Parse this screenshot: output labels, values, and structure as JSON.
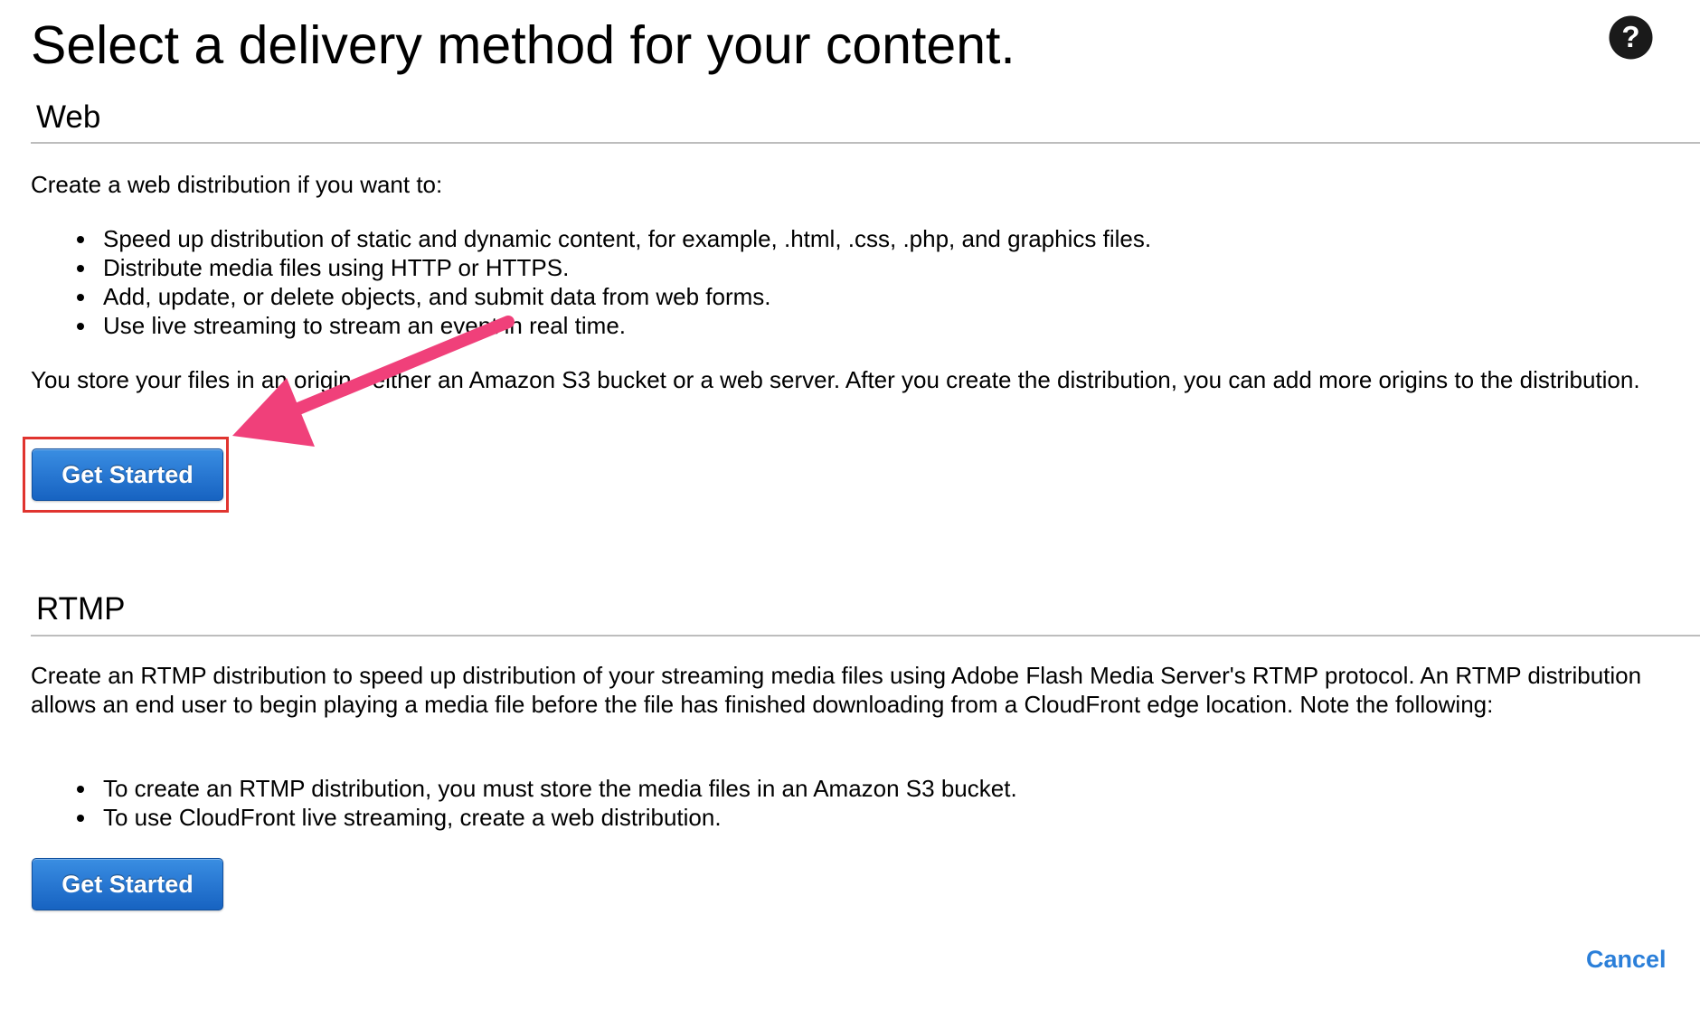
{
  "page": {
    "title": "Select a delivery method for your content."
  },
  "help": {
    "icon": "question-circle-icon",
    "glyph": "?"
  },
  "web": {
    "heading": "Web",
    "intro": "Create a web distribution if you want to:",
    "bullets": [
      "Speed up distribution of static and dynamic content, for example, .html, .css, .php, and graphics files.",
      "Distribute media files using HTTP or HTTPS.",
      "Add, update, or delete objects, and submit data from web forms.",
      "Use live streaming to stream an event in real time."
    ],
    "note": "You store your files in an origin - either an Amazon S3 bucket or a web server. After you create the distribution, you can add more origins to the distribution.",
    "button_label": "Get Started"
  },
  "rtmp": {
    "heading": "RTMP",
    "intro": "Create an RTMP distribution to speed up distribution of your streaming media files using Adobe Flash Media Server's RTMP protocol. An RTMP distribution allows an end user to begin playing a media file before the file has finished downloading from a CloudFront edge location. Note the following:",
    "bullets": [
      "To create an RTMP distribution, you must store the media files in an Amazon S3 bucket.",
      "To use CloudFront live streaming, create a web distribution."
    ],
    "button_label": "Get Started"
  },
  "footer": {
    "cancel_label": "Cancel"
  },
  "annotation": {
    "arrow_color": "#f0407a",
    "highlight_color": "#e0342f"
  },
  "colors": {
    "button_blue": "#2a7ad4",
    "link_blue": "#2b7fd9"
  }
}
